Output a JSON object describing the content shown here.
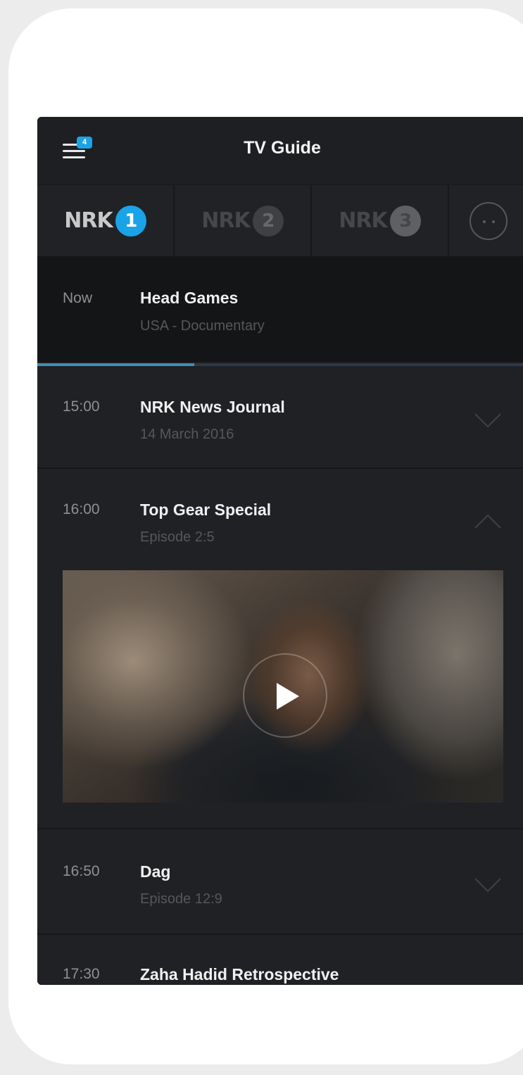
{
  "header": {
    "title": "TV Guide",
    "menu_badge": "4"
  },
  "channels": [
    {
      "logo": "nrk",
      "number": "1",
      "active": true
    },
    {
      "logo": "nrk",
      "number": "2",
      "active": false
    },
    {
      "logo": "nrk",
      "number": "3",
      "active": false
    }
  ],
  "more_icon": "more-channels-icon",
  "now": {
    "time_label": "Now",
    "title": "Head Games",
    "subtitle": "USA - Documentary",
    "progress": 0.32
  },
  "schedule": [
    {
      "time": "15:00",
      "title": "NRK News Journal",
      "subtitle": "14 March 2016",
      "expanded": false
    },
    {
      "time": "16:00",
      "title": "Top Gear Special",
      "subtitle": "Episode 2:5",
      "expanded": true
    },
    {
      "time": "16:50",
      "title": "Dag",
      "subtitle": "Episode 12:9",
      "expanded": false
    },
    {
      "time": "17:30",
      "title": "Zaha Hadid Retrospective",
      "subtitle": "",
      "expanded": false
    }
  ],
  "colors": {
    "accent": "#1aa3e8",
    "background": "#1f2124",
    "now_background": "#141517"
  }
}
